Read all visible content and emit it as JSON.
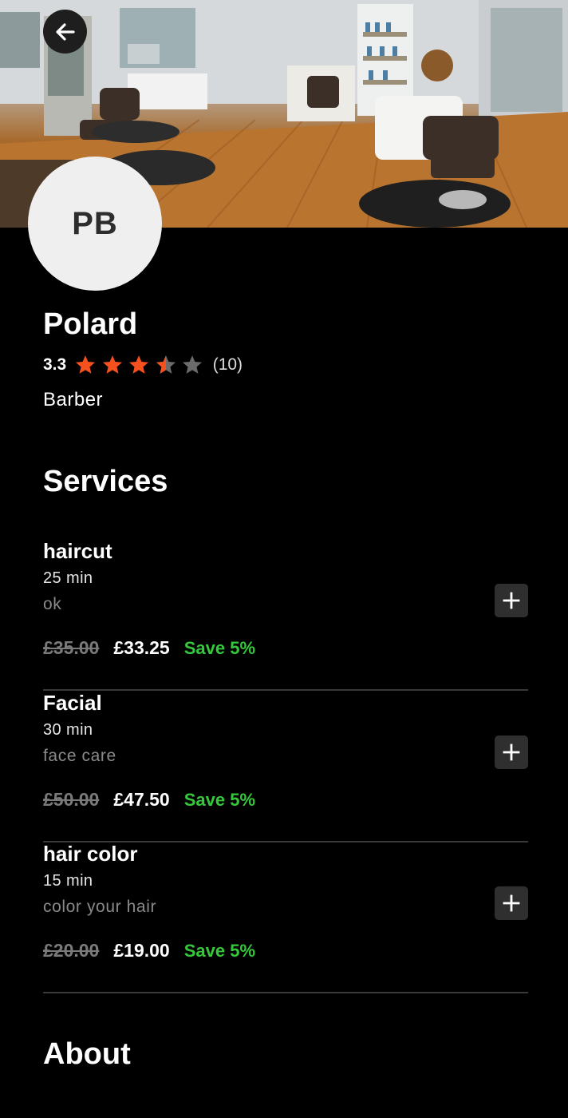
{
  "header": {
    "back_icon": "arrow-left-icon",
    "hero_image": "salon-interior-photo"
  },
  "profile": {
    "initials": "PB",
    "name": "Polard",
    "rating_value": "3.3",
    "rating_stars": 3.5,
    "rating_count": "(10)",
    "category": "Barber"
  },
  "services_title": "Services",
  "services": [
    {
      "name": "haircut",
      "duration": "25 min",
      "description": "ok",
      "old_price": "£35.00",
      "new_price": "£33.25",
      "save": "Save 5%"
    },
    {
      "name": "Facial",
      "duration": "30 min",
      "description": "face care",
      "old_price": "£50.00",
      "new_price": "£47.50",
      "save": "Save 5%"
    },
    {
      "name": "hair color",
      "duration": "15 min",
      "description": "color your hair",
      "old_price": "£20.00",
      "new_price": "£19.00",
      "save": "Save 5%"
    }
  ],
  "about_title": "About",
  "colors": {
    "background": "#000000",
    "star_filled": "#f4511e",
    "star_empty": "#6b6b6b",
    "save_green": "#35c83a",
    "avatar_bg": "#efefef"
  }
}
